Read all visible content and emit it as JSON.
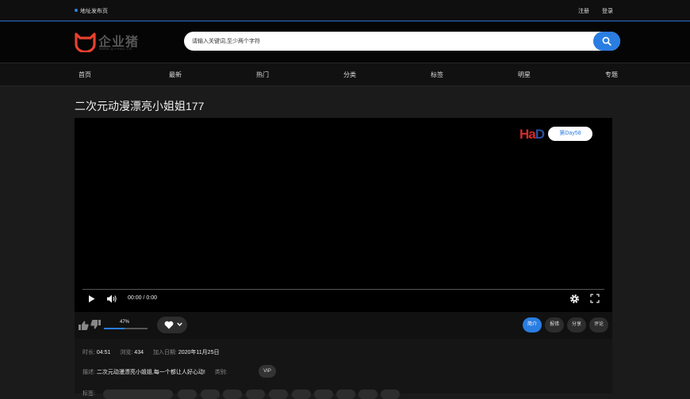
{
  "topbar": {
    "release_link": "地址发布页",
    "register": "注册",
    "login": "登录"
  },
  "header": {
    "logo_text": "企业猪",
    "logo_sub": "WWW.QIYHAO.CN",
    "search_placeholder": "请输入关键词,至少两个字符"
  },
  "nav": [
    "首页",
    "最新",
    "热门",
    "分类",
    "标签",
    "明星",
    "专题"
  ],
  "video": {
    "title": "二次元动漫漂亮小姐姐177",
    "watermark_red": "Ha",
    "watermark_blue": "D",
    "day_badge": "第Day58",
    "time": "00:00 / 0:00"
  },
  "rating": {
    "percent_label": "47%",
    "percent": 47
  },
  "tabs": [
    "简介",
    "报错",
    "分享",
    "评论"
  ],
  "info": {
    "duration_label": "时长:",
    "duration": "04:51",
    "views_label": "浏览:",
    "views": "434",
    "date_label": "加入日期:",
    "date": "2020年11月25日",
    "desc_label": "描述:",
    "desc": "二次元动漫漂亮小姐姐,每一个都让人好心动!",
    "category_label": "类别:",
    "category": "VIP",
    "tags_label": "标签:"
  },
  "colors": {
    "accent": "#2a7de1",
    "background": "#1b1b1b"
  }
}
